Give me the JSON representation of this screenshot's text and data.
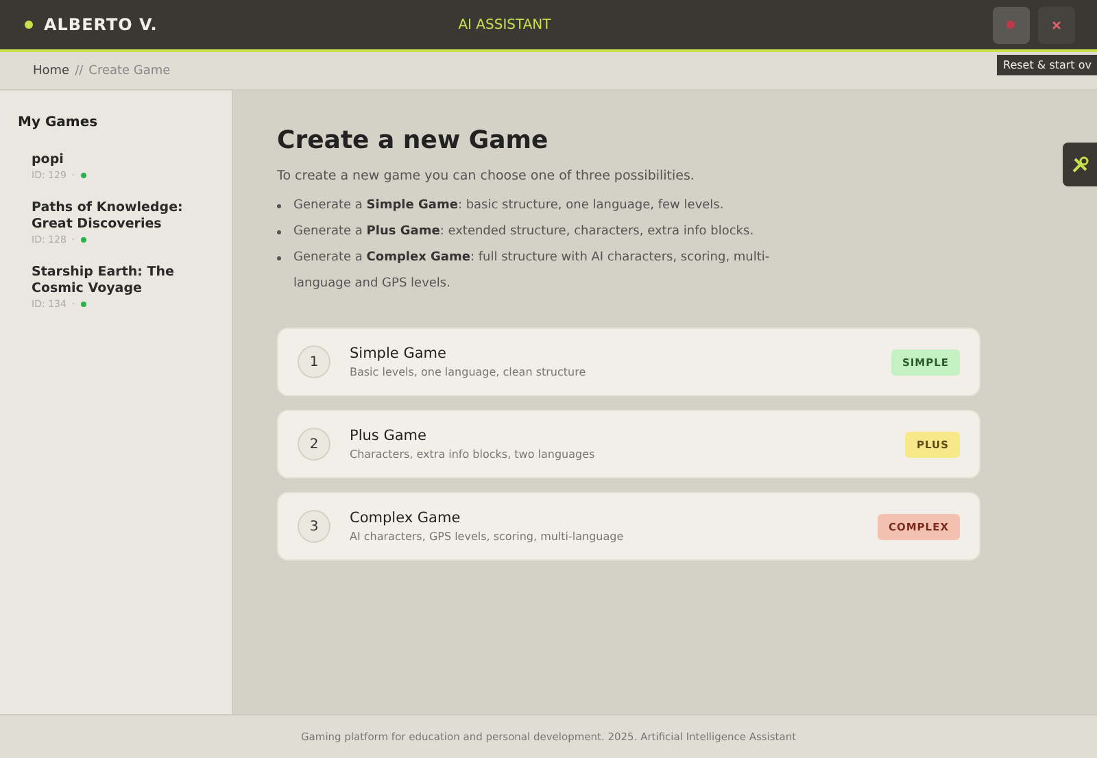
{
  "header": {
    "user": "ALBERTO V.",
    "title": "AI ASSISTANT",
    "tooltip": "Reset & start ov"
  },
  "breadcrumb": {
    "home": "Home",
    "separator": "//",
    "current": "Create Game"
  },
  "sidebar": {
    "title": "My Games",
    "items": [
      {
        "name": "popi",
        "id": "ID: 129",
        "separator": "·"
      },
      {
        "name": "Paths of Knowledge: Great Discoveries",
        "id": "ID: 128",
        "separator": "·"
      },
      {
        "name": "Starship Earth: The Cosmic Voyage",
        "id": "ID: 134",
        "separator": "·"
      }
    ]
  },
  "main": {
    "heading": "Create a new Game",
    "intro": "To create a new game you can choose one of three possibilities.",
    "bullets": [
      "Generate a **Simple Game**: basic structure, one language, few levels.",
      "Generate a **Plus Game**: extended structure, characters, extra info blocks.",
      "Generate a **Complex Game**: full structure with AI characters, scoring, multi-language and GPS levels."
    ],
    "options": [
      {
        "number": "1",
        "title": "Simple Game",
        "description": "Basic levels, one language, clean structure",
        "badge": "SIMPLE",
        "kind": "simple"
      },
      {
        "number": "2",
        "title": "Plus Game",
        "description": "Characters, extra info blocks, two languages",
        "badge": "PLUS",
        "kind": "plus"
      },
      {
        "number": "3",
        "title": "Complex Game",
        "description": "AI characters, GPS levels, scoring, multi-language",
        "badge": "COMPLEX",
        "kind": "complex"
      }
    ]
  },
  "footer": "Gaming platform for education and personal development. 2025. Artificial Intelligence Assistant"
}
